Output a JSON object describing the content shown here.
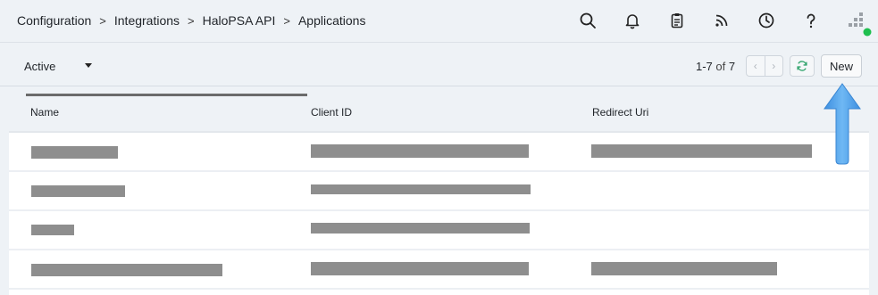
{
  "breadcrumb": {
    "items": [
      "Configuration",
      "Integrations",
      "HaloPSA API",
      "Applications"
    ],
    "separator": ">"
  },
  "header_icons": [
    "search-icon",
    "bell-icon",
    "clipboard-icon",
    "rss-icon",
    "clock-icon",
    "help-icon",
    "app-logo-icon"
  ],
  "toolbar": {
    "filter_value": "Active",
    "pager_range": "1-7",
    "pager_of": "of",
    "pager_total": "7",
    "new_label": "New"
  },
  "table": {
    "columns": [
      "Name",
      "Client ID",
      "Redirect Uri"
    ],
    "rows": [
      {
        "name": "",
        "client_id": "",
        "redirect_uri": "",
        "has_redirect": true
      },
      {
        "name": "",
        "client_id": "",
        "redirect_uri": "",
        "has_redirect": false
      },
      {
        "name": "",
        "client_id": "",
        "redirect_uri": "",
        "has_redirect": false
      },
      {
        "name": "",
        "client_id": "",
        "redirect_uri": "",
        "has_redirect": true
      }
    ]
  },
  "colors": {
    "background": "#eef2f6",
    "redaction": "#8e8e8e",
    "status_dot": "#1fbf4f",
    "arrow": "#5aa9ef",
    "refresh": "#2fa36b"
  }
}
